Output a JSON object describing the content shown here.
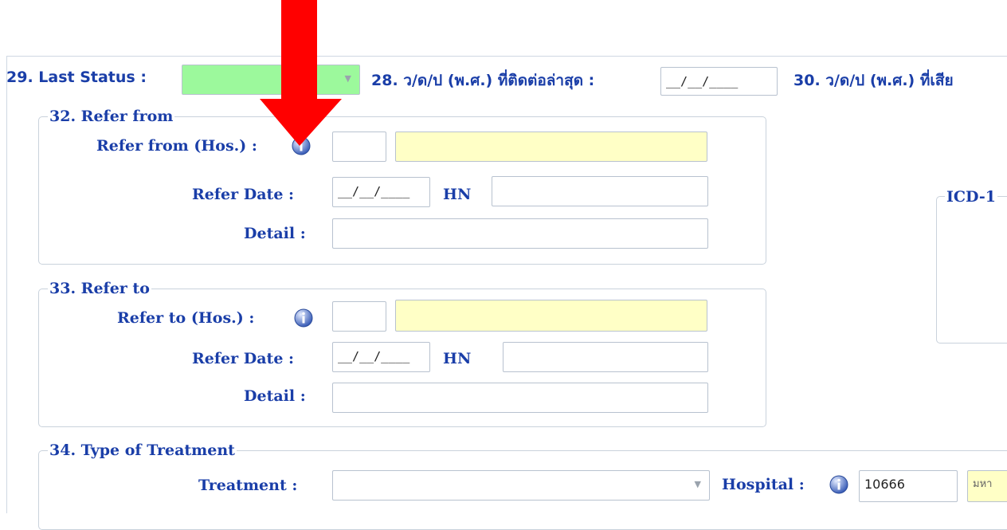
{
  "top": {
    "last_status_label": "29. Last Status :",
    "last_status_value": "",
    "contact_date_label": "28. ว/ด/ป (พ.ศ.) ที่ติดต่อล่าสุด :",
    "contact_date_value": "__/__/____",
    "death_date_label": "30. ว/ด/ป (พ.ศ.) ที่เสีย"
  },
  "refer_from": {
    "legend": "32. Refer from",
    "hos_label": "Refer from (Hos.) :",
    "hos_code": "",
    "hos_name": "",
    "date_label": "Refer Date :",
    "date_value": "__/__/____",
    "hn_label": "HN",
    "hn_value": "",
    "detail_label": "Detail :",
    "detail_value": ""
  },
  "refer_to": {
    "legend": "33. Refer to",
    "hos_label": "Refer to (Hos.) :",
    "hos_code": "",
    "hos_name": "",
    "date_label": "Refer Date :",
    "date_value": "__/__/____",
    "hn_label": "HN",
    "hn_value": "",
    "detail_label": "Detail :",
    "detail_value": ""
  },
  "icd": {
    "legend": "ICD-1"
  },
  "treatment": {
    "legend": "34. Type of Treatment",
    "treatment_label": "Treatment :",
    "treatment_value": "",
    "hospital_label": "Hospital :",
    "hospital_code": "10666",
    "hospital_name": "มหา"
  },
  "colors": {
    "label": "#1a3ea8",
    "highlight_yellow": "#ffffc6",
    "status_green": "#9cf99c",
    "arrow_red": "#ff0000"
  },
  "icons": [
    "info-icon",
    "dropdown-arrow-icon",
    "red-arrow-icon"
  ]
}
